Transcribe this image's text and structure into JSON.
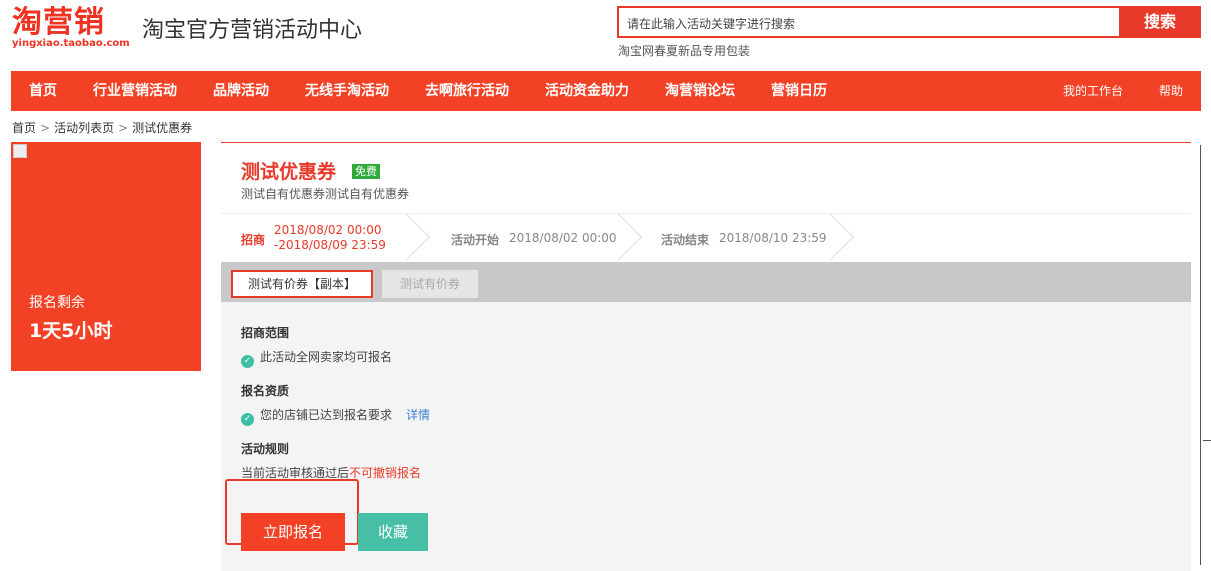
{
  "header": {
    "logo_text": "淘营销",
    "logo_sub": "yingxiao.taobao.com",
    "site_title": "淘宝官方营销活动中心",
    "search_placeholder": "请在此输入活动关键字进行搜索",
    "search_button": "搜索",
    "search_hint": "淘宝网春夏新品专用包装"
  },
  "nav": {
    "items": [
      "首页",
      "行业营销活动",
      "品牌活动",
      "无线手淘活动",
      "去啊旅行活动",
      "活动资金助力",
      "淘营销论坛",
      "营销日历"
    ],
    "right_items": [
      "我的工作台",
      "帮助"
    ]
  },
  "breadcrumb": [
    "首页",
    "活动列表页",
    "测试优惠券"
  ],
  "promo": {
    "label": "报名剩余",
    "value": "1天5小时"
  },
  "activity": {
    "title": "测试优惠券",
    "badge": "免费",
    "description": "测试自有优惠券测试自有优惠券",
    "timeline": {
      "recruit_label": "招商",
      "recruit_start": "2018/08/02 00:00",
      "recruit_end": "-2018/08/09 23:59",
      "start_label": "活动开始",
      "start_value": "2018/08/02 00:00",
      "end_label": "活动结束",
      "end_value": "2018/08/10 23:59"
    },
    "tabs": [
      "测试有价券【副本】",
      "测试有价券"
    ],
    "sections": {
      "scope_title": "招商范围",
      "scope_text": "此活动全网卖家均可报名",
      "qual_title": "报名资质",
      "qual_text": "您的店铺已达到报名要求",
      "qual_link": "详情",
      "rules_title": "活动规则",
      "rules_text": "当前活动审核通过后",
      "rules_warn": "不可撤销报名"
    },
    "buttons": {
      "signup": "立即报名",
      "favorite": "收藏"
    }
  },
  "colors": {
    "brand_red": "#f24125",
    "teal": "#46bfa6",
    "free_green": "#2eaa3b"
  }
}
